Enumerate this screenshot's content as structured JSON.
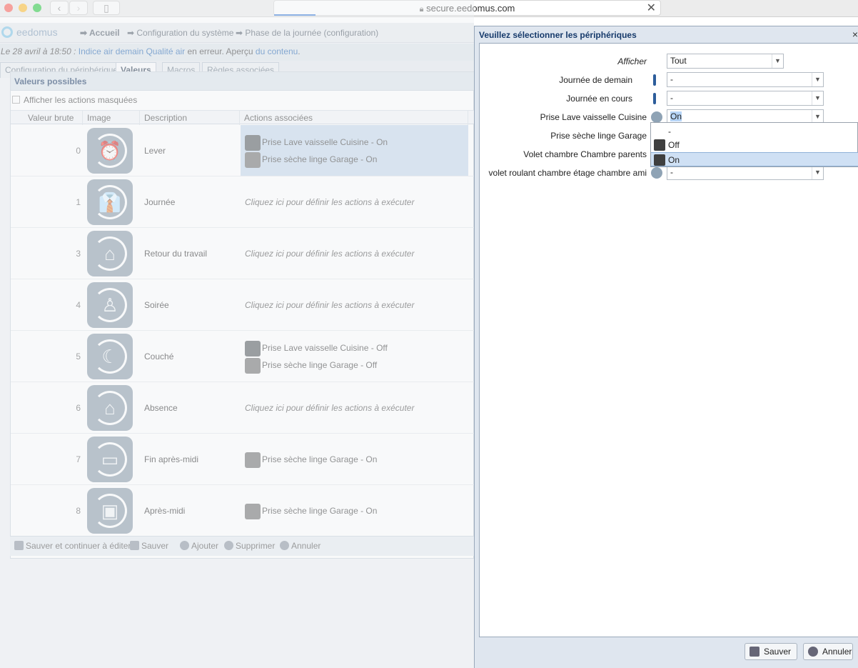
{
  "browser": {
    "url": "secure.eedomus.com"
  },
  "app": {
    "logo": "eedomus",
    "breadcrumbs": [
      "Accueil",
      "Configuration du système",
      "Phase de la journée (configuration)"
    ],
    "notice": {
      "prefix": "Le 28 avril à 18:50 : ",
      "link1": "Indice air demain Qualité air",
      "middle": " en erreur. Aperçu ",
      "link2": "du contenu",
      "suffix": "."
    },
    "tabs": [
      "Configuration du périphérique",
      "Valeurs",
      "Macros",
      "Règles associées"
    ],
    "panel_title": "Valeurs possibles",
    "show_hidden": "Afficher les actions masquées",
    "columns": [
      "Valeur brute",
      "Image",
      "Description",
      "Actions associées"
    ],
    "rows": [
      {
        "value": "0",
        "icon": "alarm-clock-icon",
        "glyph": "⏰",
        "description": "Lever",
        "actions": [
          "Prise Lave vaisselle Cuisine - On",
          "Prise sèche linge Garage - On"
        ]
      },
      {
        "value": "1",
        "icon": "tie-icon",
        "glyph": "👔",
        "description": "Journée",
        "placeholder": "Cliquez ici pour définir les actions à exécuter"
      },
      {
        "value": "3",
        "icon": "house-icon",
        "glyph": "⌂",
        "description": "Retour du travail",
        "placeholder": "Cliquez ici pour définir les actions à exécuter"
      },
      {
        "value": "4",
        "icon": "lamp-icon",
        "glyph": "♙",
        "description": "Soirée",
        "placeholder": "Cliquez ici pour définir les actions à exécuter"
      },
      {
        "value": "5",
        "icon": "moon-icon",
        "glyph": "☾",
        "description": "Couché",
        "actions": [
          "Prise Lave vaisselle Cuisine - Off",
          "Prise sèche linge Garage - Off"
        ]
      },
      {
        "value": "6",
        "icon": "house-lock-icon",
        "glyph": "⌂",
        "description": "Absence",
        "placeholder": "Cliquez ici pour définir les actions à exécuter"
      },
      {
        "value": "7",
        "icon": "sofa-icon",
        "glyph": "▭",
        "description": "Fin après-midi",
        "actions": [
          "Prise sèche linge Garage - On"
        ]
      },
      {
        "value": "8",
        "icon": "monitor-icon",
        "glyph": "▣",
        "description": "Après-midi",
        "actions": [
          "Prise sèche linge Garage - On"
        ]
      }
    ],
    "bottom_actions": [
      "Sauver et continuer à éditer",
      "Sauver",
      "Ajouter",
      "Supprimer",
      "Annuler"
    ]
  },
  "dialog": {
    "title": "Veuillez sélectionner les périphériques",
    "close": "×",
    "show_label": "Afficher",
    "show_value": "Tout",
    "fields": [
      {
        "label": "Journée de demain",
        "value": "-"
      },
      {
        "label": "Journée en cours",
        "value": "-"
      },
      {
        "label": "Prise Lave vaisselle Cuisine",
        "value": "On"
      },
      {
        "label": "Prise sèche linge Garage",
        "value": ""
      },
      {
        "label": "Volet chambre Chambre parents",
        "value": ""
      },
      {
        "label": "volet roulant chambre étage chambre ami",
        "value": "-"
      }
    ],
    "dropdown_options": [
      "-",
      "Off",
      "On"
    ],
    "save": "Sauver",
    "cancel": "Annuler"
  }
}
